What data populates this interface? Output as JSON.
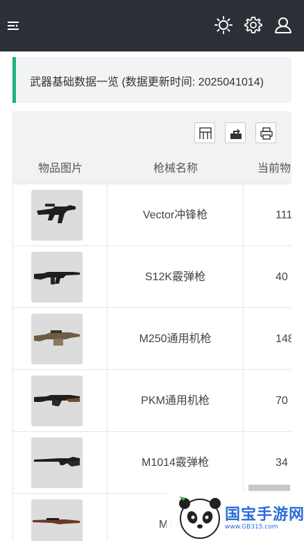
{
  "header": {
    "icons": [
      "menu-icon",
      "brightness-icon",
      "settings-icon",
      "user-icon"
    ],
    "colors": {
      "background": "#2b2f36",
      "icon": "#ffffff"
    }
  },
  "notice": {
    "text": "武器基础数据一览 (数据更新时间: 2025041014)",
    "accent": "#1fb37d"
  },
  "toolbar": {
    "icons": [
      "columns-icon",
      "export-icon",
      "print-icon"
    ]
  },
  "table": {
    "columns": [
      "物品图片",
      "枪械名称",
      "当前物"
    ],
    "rows": [
      {
        "image_icon": "smg-icon",
        "name": "Vector冲锋枪",
        "value": "111"
      },
      {
        "image_icon": "rifle-icon",
        "name": "S12K霰弹枪",
        "value": "40"
      },
      {
        "image_icon": "machine-gun-icon",
        "name": "M250通用机枪",
        "value": "148"
      },
      {
        "image_icon": "machine-gun-icon",
        "name": "PKM通用机枪",
        "value": "70"
      },
      {
        "image_icon": "shotgun-icon",
        "name": "M1014霰弹枪",
        "value": "34"
      },
      {
        "image_icon": "rifle-icon",
        "name": "M14射",
        "value": ""
      }
    ]
  },
  "watermark": {
    "title": "国宝手游网",
    "url": "www.GB315.com"
  }
}
